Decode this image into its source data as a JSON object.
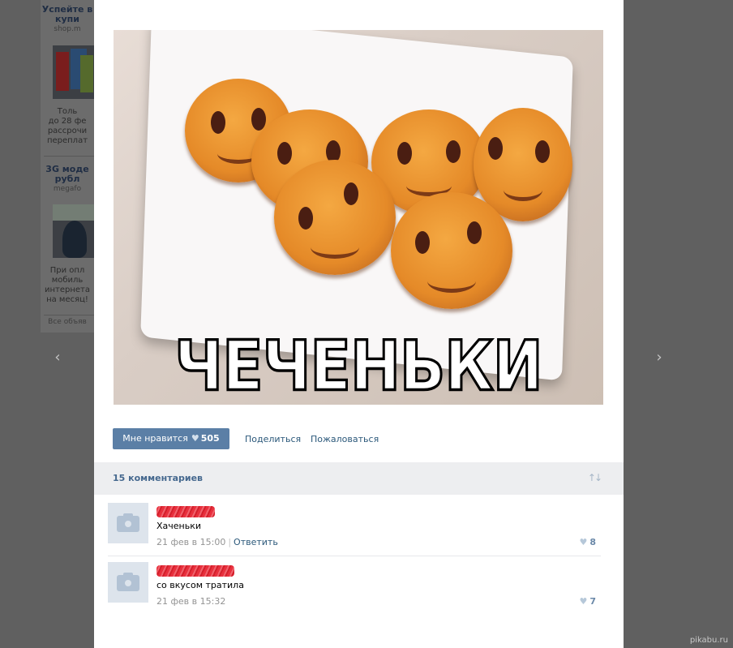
{
  "ads": [
    {
      "title": "Успейте в купи",
      "domain": "shop.m",
      "text_lines": [
        "Толь",
        "до 28 фе",
        "рассрочи",
        "переплат"
      ]
    },
    {
      "title": "3G моде рубл",
      "domain": "megafo",
      "text_lines": [
        "При опл",
        "мобиль",
        "интернета",
        "на месяц!"
      ]
    }
  ],
  "all_ads_label": "Все объяв",
  "nav": {
    "prev_icon": "‹",
    "next_icon": "›"
  },
  "photo": {
    "caption": "ЧЕЧЕНЬКИ"
  },
  "actions": {
    "like_label": "Мне нравится",
    "like_count": "505",
    "heart_icon": "♥",
    "share_label": "Поделиться",
    "report_label": "Пожаловаться"
  },
  "comments_section": {
    "count_label": "15 комментариев",
    "sort_icon": "↑↓"
  },
  "comments": [
    {
      "text": "Хаченьки",
      "date": "21 фев в 15:00",
      "reply_label": "Ответить",
      "likes": "8"
    },
    {
      "text": "со вкусом тратила",
      "date": "21 фев в 15:32",
      "likes": "7"
    }
  ],
  "watermark": "pikabu.ru",
  "colors": {
    "like_button": "#5b7fa6",
    "link": "#2b587a",
    "header_bg": "#edeef0",
    "redacted_name": "#e8303d"
  }
}
